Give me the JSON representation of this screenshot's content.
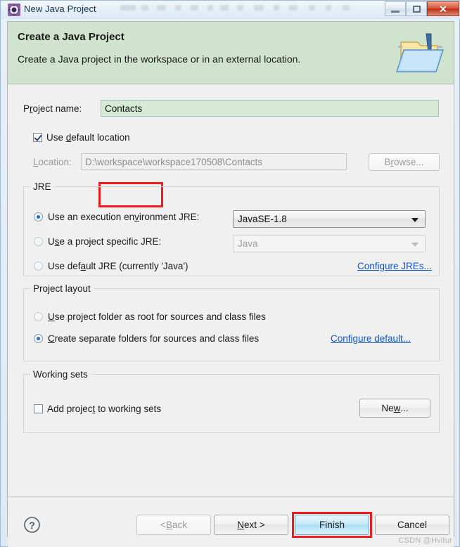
{
  "window": {
    "title": "New Java Project",
    "icon": "java-project-icon",
    "controls": {
      "minimize": "minimize-icon",
      "maximize": "maximize-icon",
      "close": "close-icon"
    }
  },
  "banner": {
    "title": "Create a Java Project",
    "subtitle": "Create a Java project in the workspace or in an external location.",
    "icon": "open-folder-java-icon",
    "background": "#cfe3cf"
  },
  "form": {
    "project_name": {
      "label_pre": "P",
      "label_key": "r",
      "label_post": "oject name:",
      "value": "Contacts",
      "placeholder": "",
      "highlighted": true,
      "highlight_color": "#ee1c1c"
    },
    "use_default_location": {
      "label_pre": "Use ",
      "label_key": "d",
      "label_post": "efault location",
      "checked": true
    },
    "location": {
      "label_pre": "",
      "label_key": "L",
      "label_post": "ocation:",
      "value": "D:\\workspace\\workspace170508\\Contacts",
      "disabled": true
    },
    "browse_button": {
      "pre": "B",
      "key": "r",
      "post": "owse...",
      "disabled": true
    }
  },
  "jre": {
    "legend": "JRE",
    "options": [
      {
        "id": "execution-environment",
        "pre": "Use an execution en",
        "key": "v",
        "post": "ironment JRE:",
        "selected": true
      },
      {
        "id": "project-specific",
        "pre": "U",
        "key": "s",
        "post": "e a project specific JRE:",
        "selected": false
      },
      {
        "id": "default-jre",
        "pre": "Use def",
        "key": "a",
        "post": "ult JRE (currently 'Java')",
        "selected": false
      }
    ],
    "environment_combo": {
      "value": "JavaSE-1.8",
      "disabled": false
    },
    "specific_combo": {
      "value": "Java",
      "disabled": true
    },
    "configure_link": "Configure JREs..."
  },
  "project_layout": {
    "legend": "Project layout",
    "options": [
      {
        "id": "use-project-folder",
        "pre": "",
        "key": "U",
        "post": "se project folder as root for sources and class files",
        "selected": false
      },
      {
        "id": "create-separate-folders",
        "pre": "",
        "key": "C",
        "post": "reate separate folders for sources and class files",
        "selected": true
      }
    ],
    "configure_link": "Configure default..."
  },
  "working_sets": {
    "legend": "Working sets",
    "checkbox": {
      "pre": "Add projec",
      "key": "t",
      "post": " to working sets",
      "checked": false
    },
    "new_button": {
      "pre": "Ne",
      "key": "w",
      "post": "..."
    }
  },
  "button_bar": {
    "help": "help-icon",
    "back": {
      "pre": "< ",
      "key": "B",
      "post": "ack",
      "disabled": true
    },
    "next": {
      "pre": "",
      "key": "N",
      "post": "ext >",
      "disabled": false
    },
    "finish": {
      "label": "Finish",
      "default": true,
      "highlighted": true
    },
    "cancel": {
      "label": "Cancel"
    }
  },
  "watermark": "CSDN @Hvitur"
}
